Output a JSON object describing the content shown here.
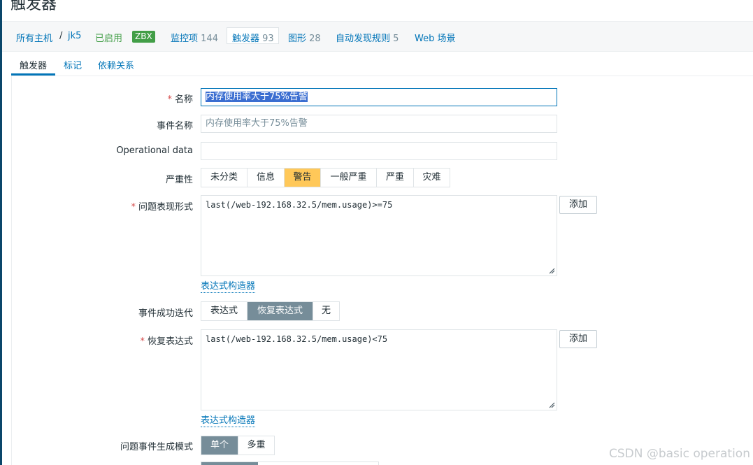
{
  "page": {
    "title": "触发器"
  },
  "breadcrumbs": {
    "all_hosts": "所有主机",
    "separator": "/",
    "host": "jk5",
    "enabled": "已启用",
    "zbx": "ZBX",
    "items_label": "监控项",
    "items_count": "144",
    "triggers_label": "触发器",
    "triggers_count": "93",
    "graphs_label": "图形",
    "graphs_count": "28",
    "discovery_label": "自动发现规则",
    "discovery_count": "5",
    "web_label": "Web 场景"
  },
  "tabs": {
    "trigger": "触发器",
    "tags": "标记",
    "dependencies": "依赖关系"
  },
  "form": {
    "name": {
      "label": "名称",
      "value": "内存使用率大于75%告警"
    },
    "event_name": {
      "label": "事件名称",
      "placeholder": "内存使用率大于75%告警"
    },
    "operational_data": {
      "label": "Operational data",
      "value": ""
    },
    "severity": {
      "label": "严重性",
      "options": [
        "未分类",
        "信息",
        "警告",
        "一般严重",
        "严重",
        "灾难"
      ],
      "selected": "警告"
    },
    "problem_expression": {
      "label": "问题表现形式",
      "value": "last(/web-192.168.32.5/mem.usage)>=75",
      "add_button": "添加",
      "builder_link": "表达式构造器"
    },
    "ok_event_generation": {
      "label": "事件成功迭代",
      "options": [
        "表达式",
        "恢复表达式",
        "无"
      ],
      "selected": "恢复表达式"
    },
    "recovery_expression": {
      "label": "恢复表达式",
      "value": "last(/web-192.168.32.5/mem.usage)<75",
      "add_button": "添加",
      "builder_link": "表达式构造器"
    },
    "problem_event_mode": {
      "label": "问题事件生成模式",
      "options": [
        "单个",
        "多重"
      ],
      "selected": "单个"
    }
  },
  "watermark": "CSDN @basic operation",
  "colors": {
    "accent": "#0275b8",
    "warning": "#ffc859",
    "enabled": "#429e47",
    "required": "#d64e4e",
    "selected_gray": "#768d99"
  }
}
